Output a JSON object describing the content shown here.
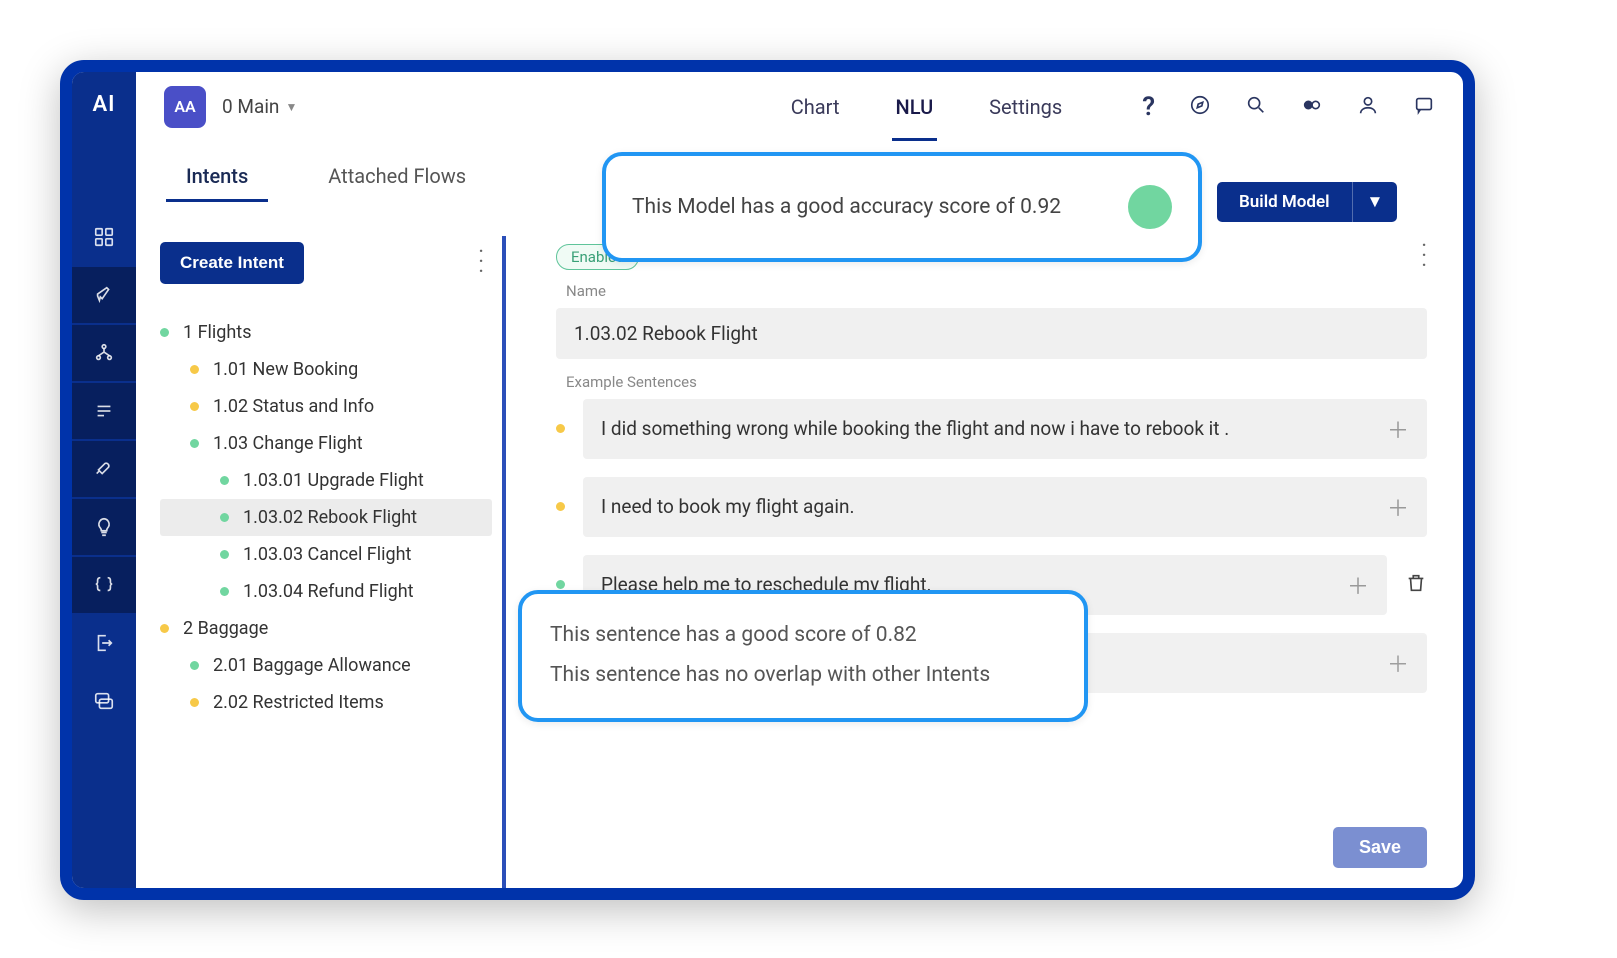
{
  "logo": "AI",
  "workspace": {
    "badge": "AA",
    "label": "0 Main"
  },
  "top_tabs": {
    "chart": "Chart",
    "nlu": "NLU",
    "settings": "Settings"
  },
  "content_tabs": {
    "intents": "Intents",
    "attached_flows": "Attached Flows"
  },
  "accuracy_tooltip": "This Model has a good accuracy score of 0.92",
  "build_model": "Build Model",
  "create_intent": "Create Intent",
  "tree": {
    "flights": "1 Flights",
    "new_booking": "1.01 New Booking",
    "status_info": "1.02 Status and Info",
    "change_flight": "1.03 Change Flight",
    "upgrade": "1.03.01 Upgrade Flight",
    "rebook": "1.03.02 Rebook Flight",
    "cancel": "1.03.03 Cancel Flight",
    "refund": "1.03.04 Refund Flight",
    "baggage": "2 Baggage",
    "allowance": "2.01 Baggage Allowance",
    "restricted": "2.02 Restricted Items"
  },
  "detail": {
    "enabled": "Enabled",
    "name_label": "Name",
    "name_value": "1.03.02 Rebook Flight",
    "examples_label": "Example Sentences",
    "example1": "I did something wrong while booking the flight and now i have to rebook it .",
    "example2": "I need to book my flight again.",
    "example3": "Please help me to reschedule my flight.",
    "save": "Save"
  },
  "sentence_tooltip": {
    "line1": "This sentence has a good score of 0.82",
    "line2": "This sentence has no overlap with other Intents"
  }
}
